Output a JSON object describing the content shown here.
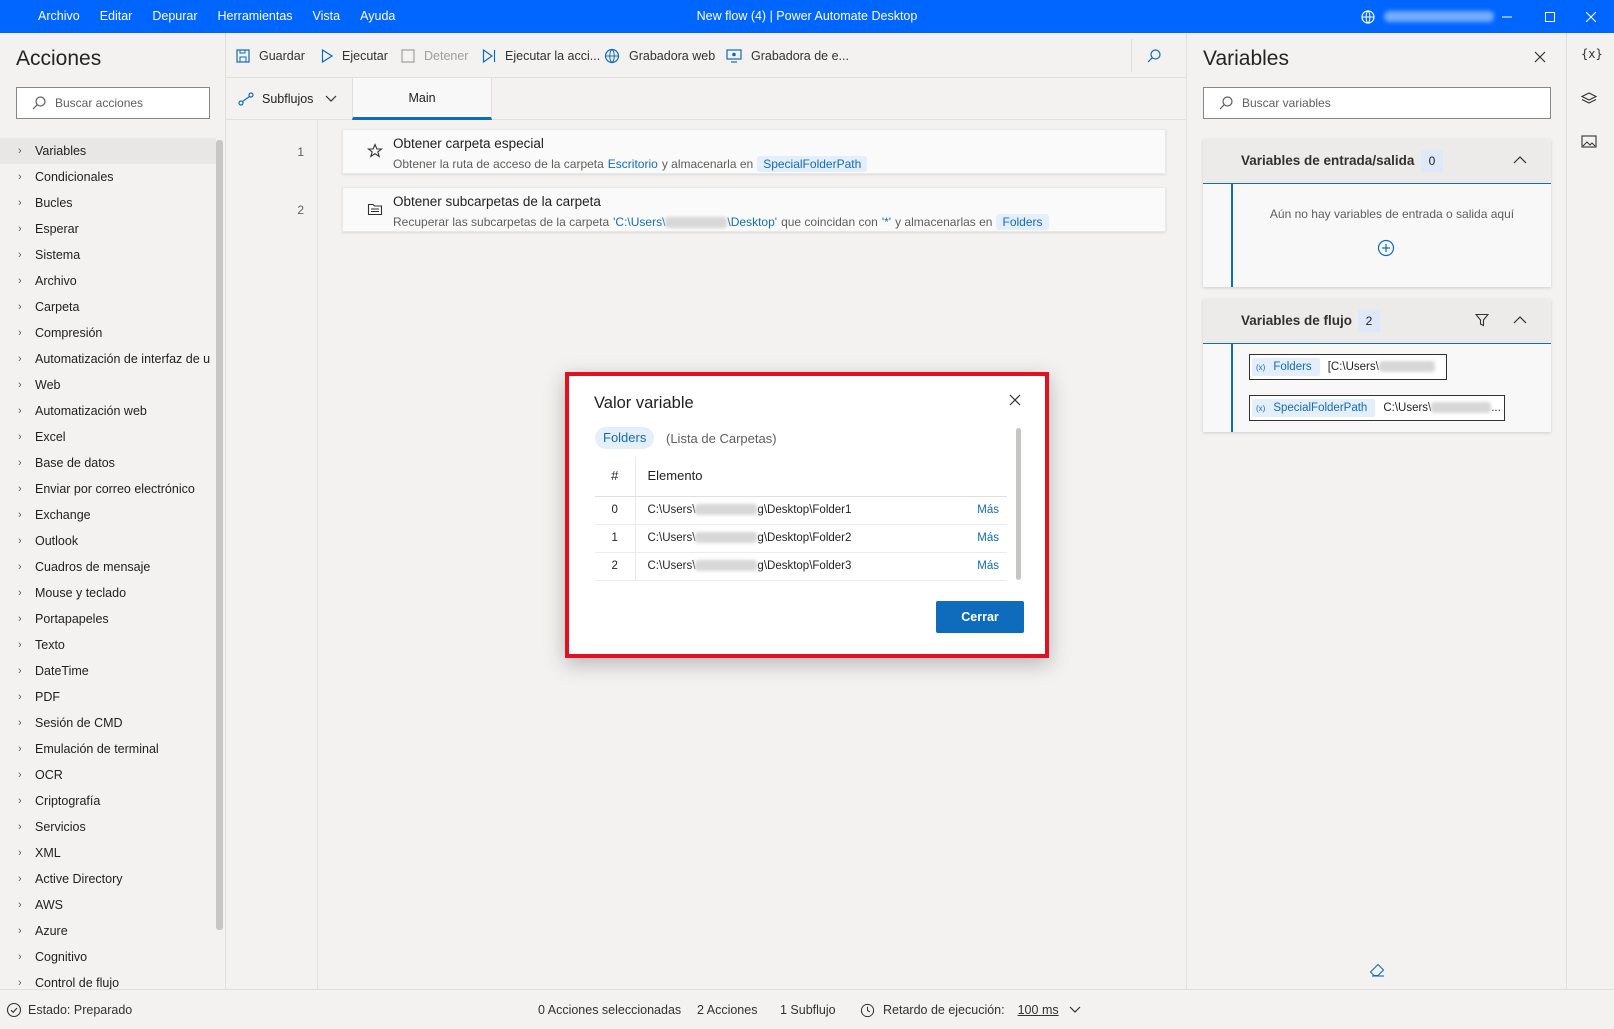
{
  "titlebar": {
    "menu": [
      "Archivo",
      "Editar",
      "Depurar",
      "Herramientas",
      "Vista",
      "Ayuda"
    ],
    "title": "New flow (4) | Power Automate Desktop"
  },
  "left": {
    "title": "Acciones",
    "search_placeholder": "Buscar acciones",
    "items": [
      "Variables",
      "Condicionales",
      "Bucles",
      "Esperar",
      "Sistema",
      "Archivo",
      "Carpeta",
      "Compresión",
      "Automatización de interfaz de u",
      "Web",
      "Automatización web",
      "Excel",
      "Base de datos",
      "Enviar por correo electrónico",
      "Exchange",
      "Outlook",
      "Cuadros de mensaje",
      "Mouse y teclado",
      "Portapapeles",
      "Texto",
      "DateTime",
      "PDF",
      "Sesión de CMD",
      "Emulación de terminal",
      "OCR",
      "Criptografía",
      "Servicios",
      "XML",
      "Active Directory",
      "AWS",
      "Azure",
      "Cognitivo",
      "Control de flujo"
    ]
  },
  "toolbar": {
    "save": "Guardar",
    "run": "Ejecutar",
    "stop": "Detener",
    "run_action": "Ejecutar la acci...",
    "web_recorder": "Grabadora web",
    "desktop_recorder": "Grabadora de e..."
  },
  "tabs": {
    "subflows": "Subflujos",
    "main": "Main"
  },
  "steps": [
    {
      "line": "1",
      "title": "Obtener carpeta especial",
      "desc_a": "Obtener la ruta de acceso de la carpeta",
      "link": "Escritorio",
      "desc_b": "y almacenarla en",
      "var": "SpecialFolderPath"
    },
    {
      "line": "2",
      "title": "Obtener subcarpetas de la carpeta",
      "desc_a": "Recuperar las subcarpetas de la carpeta",
      "path_a": "'C:\\Users\\",
      "path_b": "\\Desktop'",
      "desc_b": "que coincidan con",
      "pattern": "'*'",
      "desc_c": "y almacenarlas en",
      "var": "Folders"
    }
  ],
  "variables": {
    "title": "Variables",
    "search_placeholder": "Buscar variables",
    "io_label": "Variables de entrada/salida",
    "io_count": "0",
    "io_empty": "Aún no hay variables de entrada o salida aquí",
    "flow_label": "Variables de flujo",
    "flow_count": "2",
    "flow_vars": [
      {
        "name": "Folders",
        "value": "[C:\\Users\\"
      },
      {
        "name": "SpecialFolderPath",
        "value": "C:\\Users\\"
      }
    ]
  },
  "dialog": {
    "title": "Valor variable",
    "var_name": "Folders",
    "var_type": "(Lista de Carpetas)",
    "col_index": "#",
    "col_item": "Elemento",
    "rows": [
      {
        "index": "0",
        "pre": "C:\\Users\\",
        "post": "g\\Desktop\\Folder1",
        "more": "Más"
      },
      {
        "index": "1",
        "pre": "C:\\Users\\",
        "post": "g\\Desktop\\Folder2",
        "more": "Más"
      },
      {
        "index": "2",
        "pre": "C:\\Users\\",
        "post": "g\\Desktop\\Folder3",
        "more": "Más"
      }
    ],
    "close_label": "Cerrar",
    "frame_color": "#e3101f"
  },
  "status": {
    "state": "Estado: Preparado",
    "selected": "0 Acciones seleccionadas",
    "actions": "2 Acciones",
    "subflows": "1 Subflujo",
    "delay_label": "Retardo de ejecución:",
    "delay_value": "100 ms"
  },
  "colors": {
    "titlebar": "#0066ff",
    "accent": "#0f6cbd",
    "highlight": "#e3101f"
  }
}
